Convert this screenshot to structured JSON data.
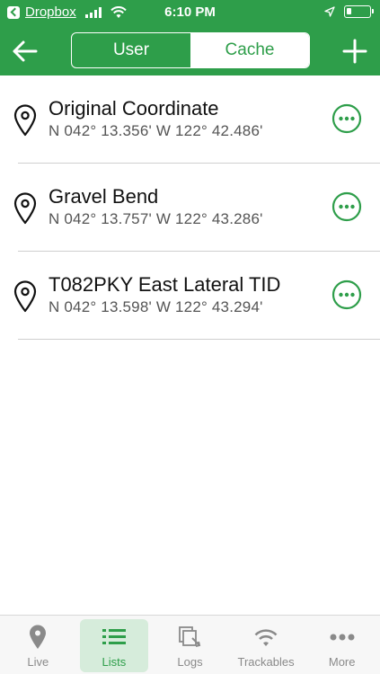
{
  "status_bar": {
    "back_app": "Dropbox",
    "time": "6:10 PM"
  },
  "nav": {
    "segments": [
      {
        "label": "User",
        "selected": false
      },
      {
        "label": "Cache",
        "selected": true
      }
    ]
  },
  "waypoints": [
    {
      "title": "Original Coordinate",
      "coords": "N 042° 13.356' W 122° 42.486'"
    },
    {
      "title": "Gravel Bend",
      "coords": "N 042° 13.757' W 122° 43.286'"
    },
    {
      "title": "T082PKY East Lateral TID",
      "coords": "N 042° 13.598' W 122° 43.294'"
    }
  ],
  "tabs": [
    {
      "label": "Live",
      "icon": "map-pin-icon",
      "active": false
    },
    {
      "label": "Lists",
      "icon": "list-icon",
      "active": true
    },
    {
      "label": "Logs",
      "icon": "logs-icon",
      "active": false
    },
    {
      "label": "Trackables",
      "icon": "trackables-icon",
      "active": false
    },
    {
      "label": "More",
      "icon": "more-icon",
      "active": false
    }
  ],
  "colors": {
    "brand_green": "#2e9e4a",
    "active_tab_bg": "#d6ecdb",
    "inactive_gray": "#8a8a8a"
  }
}
